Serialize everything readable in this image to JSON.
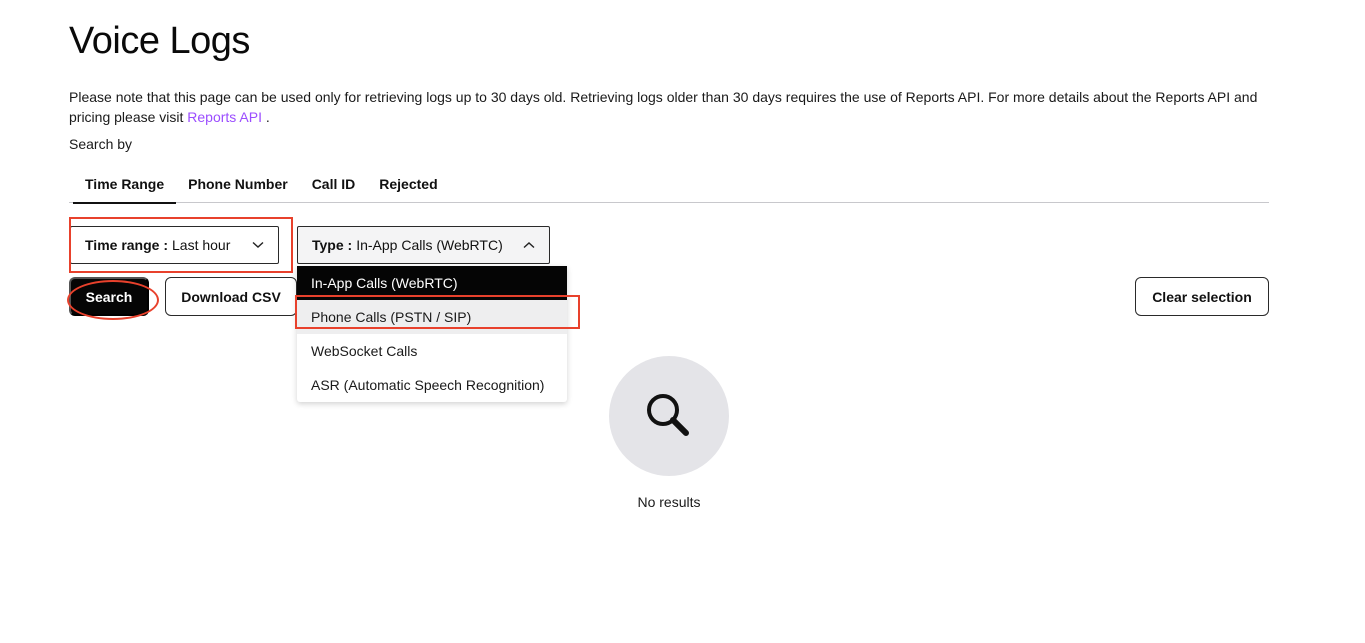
{
  "page": {
    "title": "Voice Logs",
    "notice_text": "Please note that this page can be used only for retrieving logs up to 30 days old. Retrieving logs older than 30 days requires the use of Reports API. For more details about the Reports API and pricing please visit ",
    "notice_link": "Reports API",
    "notice_end": " .",
    "search_by_label": "Search by"
  },
  "tabs": [
    {
      "label": "Time Range",
      "active": true
    },
    {
      "label": "Phone Number",
      "active": false
    },
    {
      "label": "Call ID",
      "active": false
    },
    {
      "label": "Rejected",
      "active": false
    }
  ],
  "filters": {
    "time_range": {
      "label": "Time range :",
      "value": "Last hour",
      "icon": "chevron-down-icon"
    },
    "type": {
      "label": "Type :",
      "value": "In-App Calls (WebRTC)",
      "icon": "chevron-up-icon"
    }
  },
  "type_options": [
    {
      "label": "In-App Calls (WebRTC)"
    },
    {
      "label": "Phone Calls (PSTN / SIP)"
    },
    {
      "label": "WebSocket Calls"
    },
    {
      "label": "ASR (Automatic Speech Recognition)"
    }
  ],
  "buttons": {
    "search": "Search",
    "download_csv": "Download CSV",
    "clear_selection": "Clear selection"
  },
  "empty_state": {
    "icon": "search-icon",
    "text": "No results"
  },
  "colors": {
    "link": "#9b4dff",
    "highlight": "#e8412c",
    "primary_button": "#050505"
  }
}
